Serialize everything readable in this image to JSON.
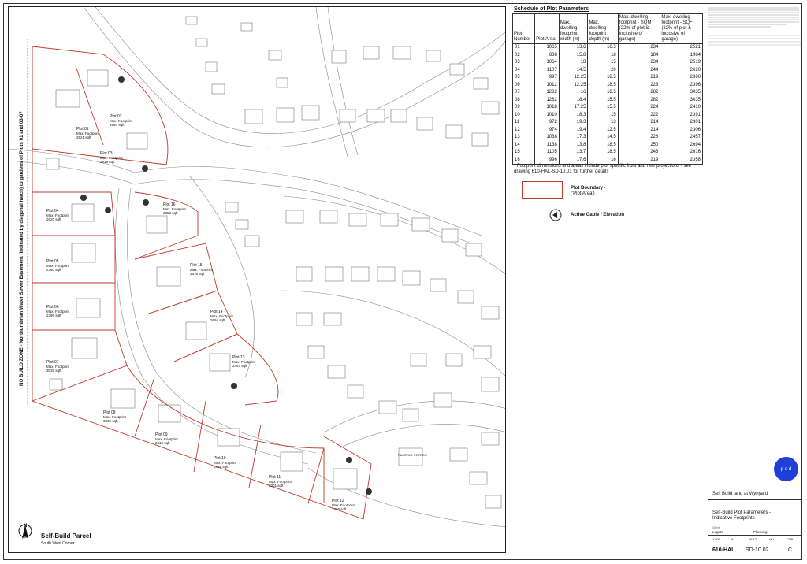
{
  "schedule": {
    "title": "Schedule of Plot Parameters",
    "headers": [
      "Plot Number",
      "Plot Area",
      "Max. dwelling footprint width (m)",
      "Max. dwelling footprint depth (m)",
      "Max. dwelling footprint - SQM (22% of plot & inclusive of garage)",
      "Max. dwelling footprint - SQFT (22% of plot & inclusive of garage)"
    ],
    "rows": [
      [
        "01",
        "1065",
        "13.6",
        "16.5",
        "234",
        "2521"
      ],
      [
        "02",
        "838",
        "15.8",
        "18",
        "184",
        "1984"
      ],
      [
        "03",
        "1064",
        "18",
        "15",
        "234",
        "2519"
      ],
      [
        "04",
        "1107",
        "14.5",
        "20",
        "244",
        "2620"
      ],
      [
        "05",
        "997",
        "12.25",
        "18.5",
        "219",
        "2360"
      ],
      [
        "06",
        "1012",
        "12.25",
        "18.5",
        "223",
        "2396"
      ],
      [
        "07",
        "1282",
        "16",
        "18.5",
        "282",
        "3035"
      ],
      [
        "08",
        "1282",
        "18.4",
        "15.5",
        "282",
        "3035"
      ],
      [
        "09",
        "1018",
        "17.25",
        "15.5",
        "224",
        "2410"
      ],
      [
        "10",
        "1010",
        "18.3",
        "15",
        "222",
        "2391"
      ],
      [
        "11",
        "972",
        "19.3",
        "13",
        "214",
        "2301"
      ],
      [
        "12",
        "974",
        "19.4",
        "12.5",
        "214",
        "2306"
      ],
      [
        "13",
        "1038",
        "17.3",
        "14.5",
        "228",
        "2457"
      ],
      [
        "14",
        "1138",
        "13.8",
        "18.5",
        "250",
        "2694"
      ],
      [
        "15",
        "1105",
        "13.7",
        "18.5",
        "243",
        "2616"
      ],
      [
        "16",
        "996",
        "17.6",
        "16",
        "219",
        "2358"
      ]
    ]
  },
  "note": "* Footprint dimensions and areas include plot specific front and rear projections - see drawing 610-HAL-SD-10.01 for further details",
  "legend": {
    "boundary_label": "Plot Boundary -",
    "boundary_sub": "('Plot Area')",
    "gable_label": "Active Gable / Elevation"
  },
  "map": {
    "vertical_text": "NO BUILD ZONE - Northumbrian Water Sewer Easement (indicated by diagonal hatch) to gardens of Plots 01 and 03-07",
    "title": "Self-Build Parcel",
    "subtitle": "South West Corner",
    "north": "N",
    "pumping_station": "PUMPING STATION",
    "plot_sub": "Max. Footprint",
    "plots": [
      {
        "name": "Plot 01",
        "area": "2521 sqft"
      },
      {
        "name": "Plot 02",
        "area": "1984 sqft"
      },
      {
        "name": "Plot 03",
        "area": "2519 sqft"
      },
      {
        "name": "Plot 04",
        "area": "2620 sqft"
      },
      {
        "name": "Plot 05",
        "area": "2360 sqft"
      },
      {
        "name": "Plot 06",
        "area": "2396 sqft"
      },
      {
        "name": "Plot 07",
        "area": "3035 sqft"
      },
      {
        "name": "Plot 08",
        "area": "3035 sqft"
      },
      {
        "name": "Plot 09",
        "area": "2410 sqft"
      },
      {
        "name": "Plot 10",
        "area": "2391 sqft"
      },
      {
        "name": "Plot 11",
        "area": "2301 sqft"
      },
      {
        "name": "Plot 12",
        "area": "2306 sqft"
      },
      {
        "name": "Plot 13",
        "area": "2457 sqft"
      },
      {
        "name": "Plot 14",
        "area": "2694 sqft"
      },
      {
        "name": "Plot 15",
        "area": "2616 sqft"
      },
      {
        "name": "Plot 16",
        "area": "2358 sqft"
      }
    ]
  },
  "titleblock": {
    "logo": "p o d",
    "project": "Self Build land at Wynyard",
    "drawing_title_1": "Self-Build Plot Parameters -",
    "drawing_title_2": "Indicative Footprints",
    "client_label": "Client",
    "client": "Legato",
    "status": "Planning",
    "scale": "1:500",
    "size": "A1",
    "date": "06/17",
    "drawn": "HD",
    "checked": "CVB",
    "job": "610-HAL",
    "drawing_no": "SD-10.02",
    "rev": "C"
  }
}
